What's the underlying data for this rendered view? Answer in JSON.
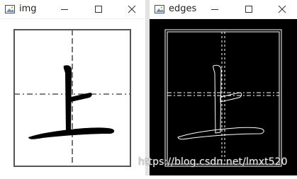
{
  "windows": [
    {
      "id": "img",
      "title": "img"
    },
    {
      "id": "edges",
      "title": "edges"
    }
  ],
  "controls": {
    "minimize": "minimize",
    "maximize": "maximize",
    "close": "close"
  },
  "watermark": "https://blog.csdn.net/lmxt520"
}
